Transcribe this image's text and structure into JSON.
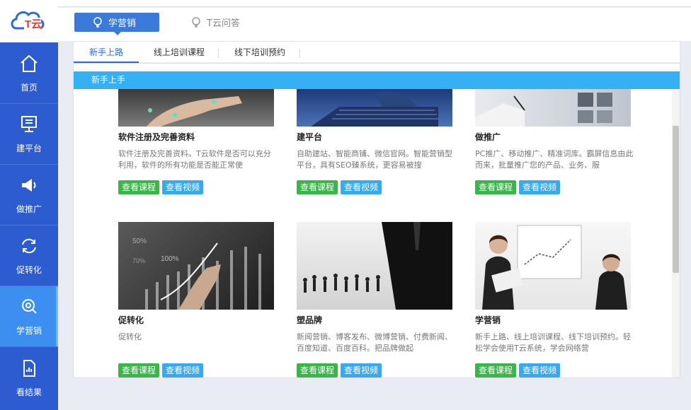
{
  "sidebar": {
    "logo_text": "T云",
    "items": [
      {
        "label": "首页",
        "icon": "home-icon"
      },
      {
        "label": "建平台",
        "icon": "monitor-icon"
      },
      {
        "label": "做推广",
        "icon": "megaphone-icon"
      },
      {
        "label": "促转化",
        "icon": "refresh-icon"
      },
      {
        "label": "学营销",
        "icon": "search-learn-icon"
      },
      {
        "label": "看结果",
        "icon": "document-icon"
      }
    ],
    "active_index": 4
  },
  "header": {
    "tabs": [
      {
        "label": "学营销",
        "icon": "lightbulb-icon"
      },
      {
        "label": "T云问答",
        "icon": "lightbulb-icon"
      }
    ]
  },
  "subnav": {
    "tabs": [
      "新手上路",
      "线上培训课程",
      "线下培训预约"
    ]
  },
  "panel": {
    "heading": "新手上手",
    "cards": [
      {
        "title": "软件注册及完善资料",
        "desc": "软件注册及完善资料。T云软件是否可以充分利用，软件的所有功能是否能正常使",
        "course_label": "查看课程",
        "video_label": "查看视频"
      },
      {
        "title": "建平台",
        "desc": "自助建站、智能商铺、微信官网。智能营销型平台，具有SEO臻系统，更容易被搜",
        "course_label": "查看课程",
        "video_label": "查看视频"
      },
      {
        "title": "做推广",
        "desc": "PC推广、移动推广、精准词库。霸屏信息由此而来，批量推广您的产品、业务、服",
        "course_label": "查看课程",
        "video_label": "查看视频"
      },
      {
        "title": "促转化",
        "desc": "促转化",
        "course_label": "查看课程",
        "video_label": "查看视频"
      },
      {
        "title": "塑品牌",
        "desc": "新闻营销、博客发布、微博营销、付费新闻、百度知道、百度百科。把品牌做起",
        "course_label": "查看课程",
        "video_label": "查看视频"
      },
      {
        "title": "学营销",
        "desc": "新手上路、线上培训课程、线下培训预约。轻松学会使用T云系统，学会网络营",
        "course_label": "查看课程",
        "video_label": "查看视频"
      }
    ]
  },
  "colors": {
    "sidebar": "#2d5bd0",
    "sidebar_active": "#3c8ff0",
    "panel_head": "#36b0f5",
    "btn_course": "#39b54a",
    "btn_video": "#38a8ef"
  }
}
